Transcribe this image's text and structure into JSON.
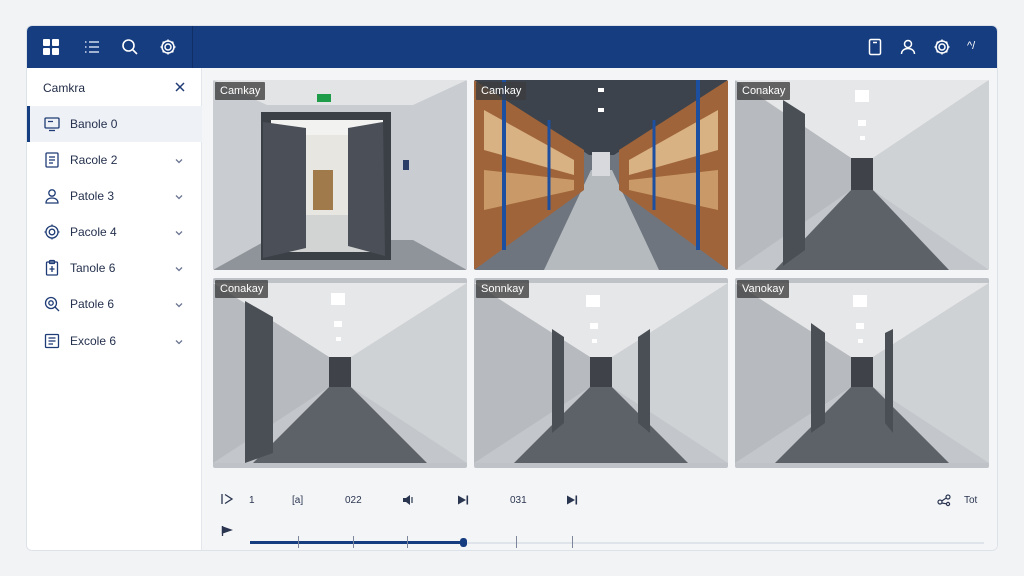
{
  "topbar": {
    "left_icons": [
      "grid-icon",
      "list-icon",
      "search-icon",
      "gear-icon"
    ],
    "right_icons": [
      "tablet-icon",
      "user-icon",
      "gear-icon"
    ],
    "right_text": "^/"
  },
  "sidebar": {
    "title": "Camkra",
    "items": [
      {
        "label": "Banole 0",
        "icon": "monitor-icon",
        "active": true,
        "chevron": false
      },
      {
        "label": "Racole 2",
        "icon": "document-icon",
        "active": false,
        "chevron": true
      },
      {
        "label": "Patole 3",
        "icon": "user-icon",
        "active": false,
        "chevron": true
      },
      {
        "label": "Pacole 4",
        "icon": "gear-icon",
        "active": false,
        "chevron": true
      },
      {
        "label": "Tanole 6",
        "icon": "clipboard-icon",
        "active": false,
        "chevron": true
      },
      {
        "label": "Patole 6",
        "icon": "search-icon",
        "active": false,
        "chevron": true
      },
      {
        "label": "Excole 6",
        "icon": "list-document-icon",
        "active": false,
        "chevron": true
      }
    ]
  },
  "cameras": [
    {
      "label": "Camkay",
      "scene": "door"
    },
    {
      "label": "Camkay",
      "scene": "warehouse"
    },
    {
      "label": "Conakay",
      "scene": "corridor"
    },
    {
      "label": "Conakay",
      "scene": "corridor"
    },
    {
      "label": "Sonnkay",
      "scene": "corridor"
    },
    {
      "label": "Vanokay",
      "scene": "corridor"
    }
  ],
  "timeline": {
    "labels": [
      "1",
      "[a]",
      "022",
      "031",
      "Tot"
    ],
    "progress": 0.29,
    "colors": {
      "accent": "#163d7f",
      "track": "#dfe3ea"
    }
  }
}
